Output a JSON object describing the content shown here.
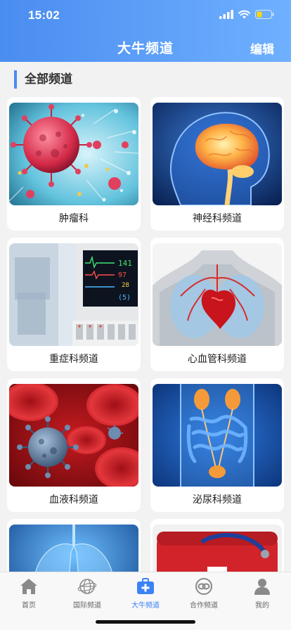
{
  "status_bar": {
    "time": "15:02"
  },
  "nav": {
    "title": "大牛频道",
    "edit_label": "编辑"
  },
  "section": {
    "title": "全部频道"
  },
  "channels": [
    {
      "label": "肿瘤科",
      "image": "virus-cells"
    },
    {
      "label": "神经科频道",
      "image": "brain-scan"
    },
    {
      "label": "重症科频道",
      "image": "icu-monitor"
    },
    {
      "label": "心血管科频道",
      "image": "heart-anatomy"
    },
    {
      "label": "血液科频道",
      "image": "blood-cells"
    },
    {
      "label": "泌尿科频道",
      "image": "urinary-system"
    },
    {
      "label": "",
      "image": "lungs"
    },
    {
      "label": "",
      "image": "medical-kit"
    }
  ],
  "monitor": {
    "v1": "141",
    "v2": "97",
    "v3": "28",
    "v4": "(5)"
  },
  "tabs": [
    {
      "label": "首页",
      "icon": "home-icon"
    },
    {
      "label": "国际频道",
      "icon": "globe-icon"
    },
    {
      "label": "大牛频道",
      "icon": "medical-kit-icon"
    },
    {
      "label": "合作频道",
      "icon": "cooperation-icon"
    },
    {
      "label": "我的",
      "icon": "user-icon"
    }
  ],
  "colors": {
    "accent": "#4a8df0",
    "active_tab": "#3b82f6"
  }
}
